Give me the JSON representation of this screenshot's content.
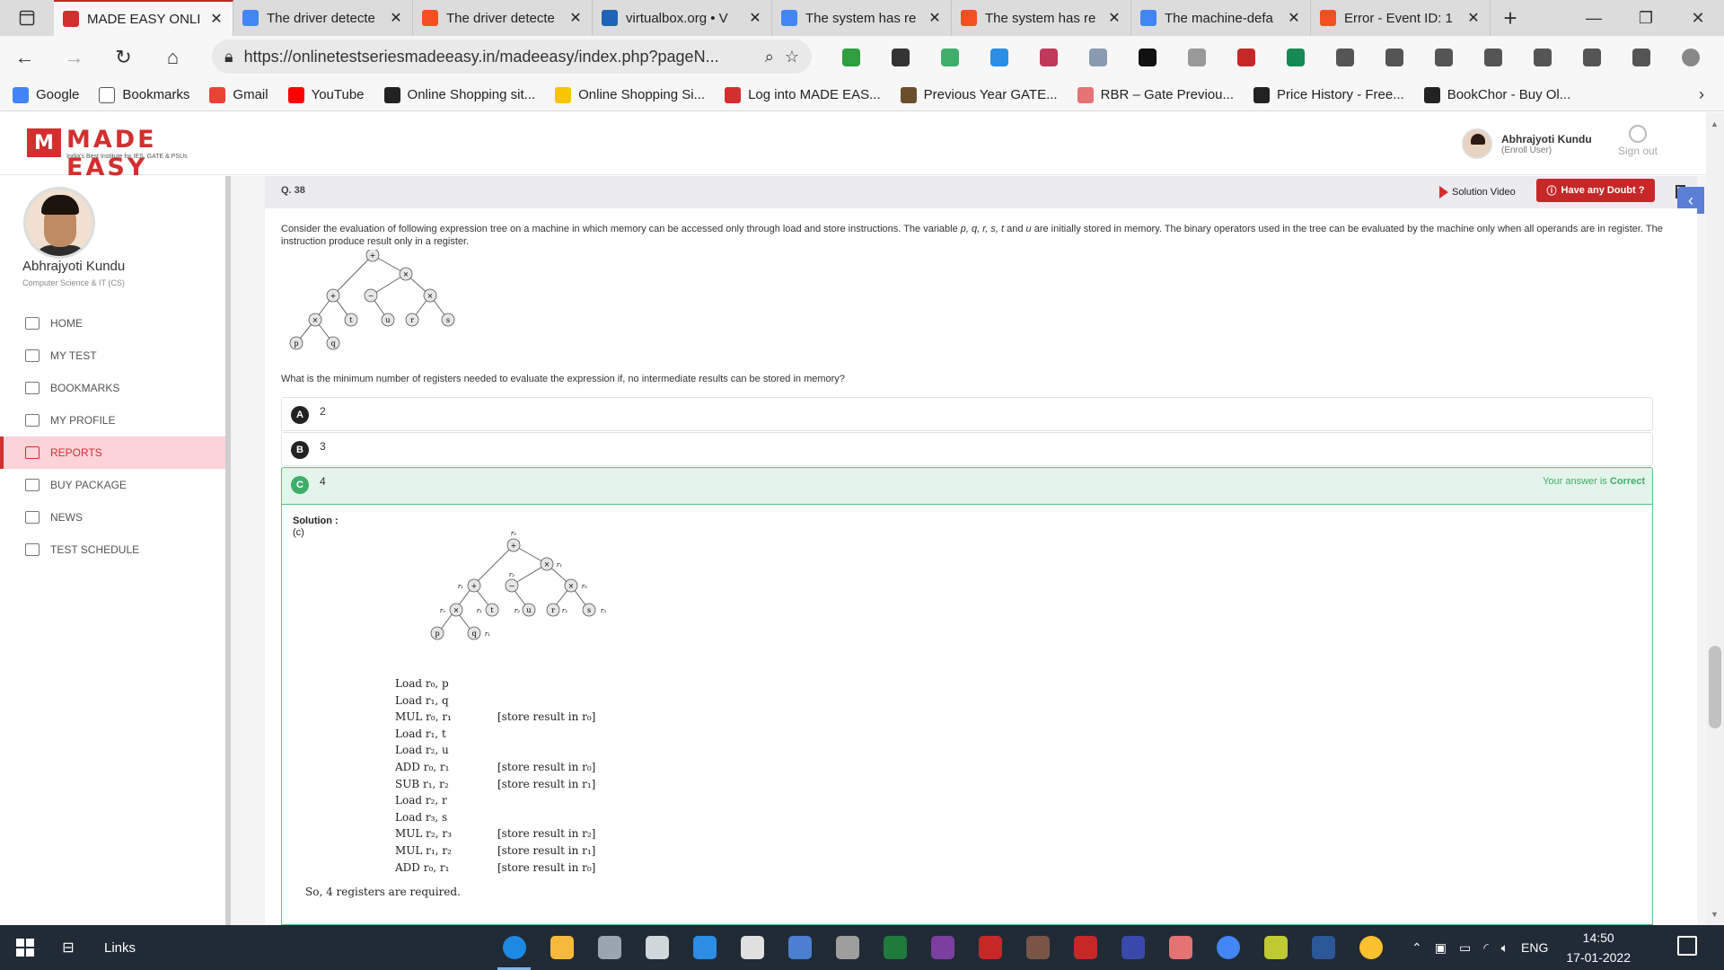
{
  "browser": {
    "tabs": [
      {
        "title": "MADE EASY ONLI",
        "icon_color": "#d32f2f",
        "active": true
      },
      {
        "title": "The driver detecte",
        "icon_color": "#4285f4",
        "active": false
      },
      {
        "title": "The driver detecte",
        "icon_color": "#f25022",
        "active": false
      },
      {
        "title": "virtualbox.org • V",
        "icon_color": "#1e63b5",
        "active": false
      },
      {
        "title": "The system has re",
        "icon_color": "#4285f4",
        "active": false
      },
      {
        "title": "The system has re",
        "icon_color": "#f25022",
        "active": false
      },
      {
        "title": "The machine-defa",
        "icon_color": "#4285f4",
        "active": false
      },
      {
        "title": "Error - Event ID: 1",
        "icon_color": "#f25022",
        "active": false
      }
    ],
    "close_glyph": "✕",
    "new_tab_glyph": "+",
    "url": "https://onlinetestseriesmadeeasy.in/madeeasy/index.php?pageN...",
    "bookmarks": [
      {
        "label": "Google",
        "icon_color": "#4285f4"
      },
      {
        "label": "Bookmarks",
        "icon_color": "#ffffff"
      },
      {
        "label": "Gmail",
        "icon_color": "#ea4335"
      },
      {
        "label": "YouTube",
        "icon_color": "#ff0000"
      },
      {
        "label": "Online Shopping sit...",
        "icon_color": "#222222"
      },
      {
        "label": "Online Shopping Si...",
        "icon_color": "#f7c600"
      },
      {
        "label": "Log into MADE EAS...",
        "icon_color": "#d32f2f"
      },
      {
        "label": "Previous Year GATE...",
        "icon_color": "#6b4f2a"
      },
      {
        "label": "RBR – Gate Previou...",
        "icon_color": "#e57373"
      },
      {
        "label": "Price History - Free...",
        "icon_color": "#222222"
      },
      {
        "label": "BookChor - Buy Ol...",
        "icon_color": "#222222"
      }
    ],
    "extensions": [
      "#2e9e3f",
      "#333333",
      "#3fae6a",
      "#2b8de3",
      "#c0395a",
      "#8a9ab0",
      "#111111",
      "#999999",
      "#c62828",
      "#168a52",
      "#555555",
      "#555555",
      "#555555",
      "#555555",
      "#555555",
      "#555555",
      "#555555",
      "#888888"
    ]
  },
  "header": {
    "logo_text": "MADE EASY",
    "logo_tagline": "India's Best Institute for IES, GATE & PSUs",
    "user_name": "Abhrajyoti Kundu",
    "user_role": "(Enroll User)",
    "signout_label": "Sign out"
  },
  "sidebar": {
    "name": "Abhrajyoti Kundu",
    "branch": "Computer Science & IT (CS)",
    "items": [
      {
        "label": "HOME",
        "active": false
      },
      {
        "label": "MY TEST",
        "active": false
      },
      {
        "label": "BOOKMARKS",
        "active": false
      },
      {
        "label": "MY PROFILE",
        "active": false
      },
      {
        "label": "REPORTS",
        "active": true
      },
      {
        "label": "BUY PACKAGE",
        "active": false
      },
      {
        "label": "NEWS",
        "active": false
      },
      {
        "label": "TEST SCHEDULE",
        "active": false
      }
    ]
  },
  "question": {
    "number": "Q. 38",
    "solution_video_label": "Solution Video",
    "doubt_label": "Have any Doubt ?",
    "text_html_parts": [
      "Consider the evaluation of following expression tree on a machine in which memory can be accessed only through load and store instructions. The variable ",
      "p, q, r, s, t",
      " and ",
      "u",
      " are initially stored in memory. The binary operators used in the tree can be evaluated by the machine only when all operands are in register. The instruction produce result only in a register."
    ],
    "tree_nodes": [
      "+",
      "×",
      "+",
      "−",
      "×",
      "×",
      "t",
      "u",
      "r",
      "s",
      "p",
      "q"
    ],
    "prompt": "What is the minimum number of registers needed to evaluate the expression if, no intermediate results can be stored in memory?",
    "options": [
      {
        "letter": "A",
        "value": "2"
      },
      {
        "letter": "B",
        "value": "3"
      },
      {
        "letter": "C",
        "value": "4"
      }
    ],
    "verdict_prefix": "Your answer is ",
    "verdict_word": "Correct"
  },
  "solution": {
    "title": "Solution :",
    "answer": "(c)",
    "steps": [
      {
        "instr": "Load r₀, p",
        "note": ""
      },
      {
        "instr": "Load r₁, q",
        "note": ""
      },
      {
        "instr": "MUL r₀, r₁",
        "note": "[store result in r₀]"
      },
      {
        "instr": "Load r₁, t",
        "note": ""
      },
      {
        "instr": "Load r₂, u",
        "note": ""
      },
      {
        "instr": "ADD r₀, r₁",
        "note": "[store result in r₀]"
      },
      {
        "instr": "SUB r₁, r₂",
        "note": "[store result in r₁]"
      },
      {
        "instr": "Load r₂, r",
        "note": ""
      },
      {
        "instr": "Load r₃, s",
        "note": ""
      },
      {
        "instr": "MUL r₂, r₃",
        "note": "[store result in r₂]"
      },
      {
        "instr": "MUL r₁, r₂",
        "note": "[store result in r₁]"
      },
      {
        "instr": "ADD r₀, r₁",
        "note": "[store result in r₀]"
      }
    ],
    "conclusion": "So, 4 registers are required.",
    "tree_labels": [
      "r₀",
      "r₁",
      "r₁",
      "r₂",
      "r₀",
      "r₀",
      "r₁",
      "r₂",
      "r₂",
      "r₃",
      "r₀",
      "r₁"
    ]
  },
  "taskbar": {
    "links_label": "Links",
    "apps": [
      "#1e88e5",
      "#f6b93b",
      "#9aa5b1",
      "#cfd8dc",
      "#2b8de3",
      "#e0e0e0",
      "#4a7fd1",
      "#9e9e9e",
      "#1f7a3c",
      "#7b3fa0",
      "#c62828",
      "#795548",
      "#c62828",
      "#3949ab",
      "#e57373",
      "#4285f4",
      "#c0ca33",
      "#2b5797",
      "#fbc02d"
    ],
    "language": "ENG",
    "time": "14:50",
    "date": "17-01-2022"
  }
}
